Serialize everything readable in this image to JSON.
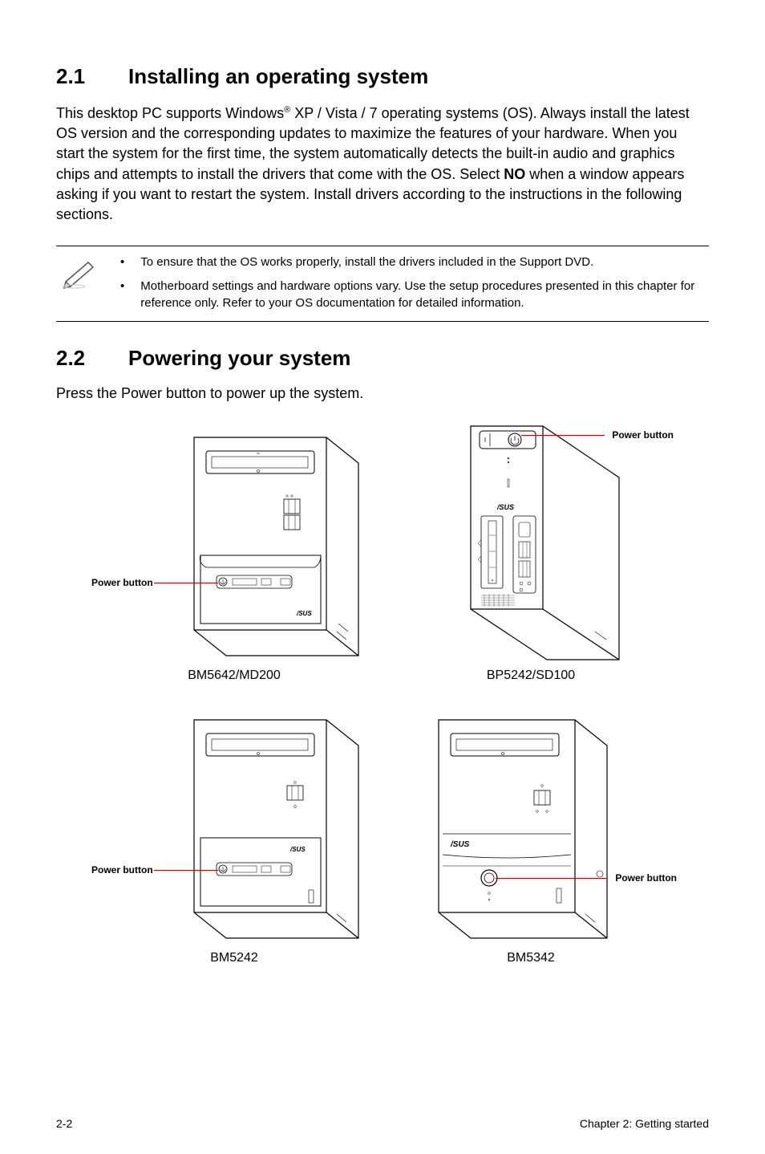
{
  "section1": {
    "number": "2.1",
    "title": "Installing an operating system",
    "intro_pre": "This desktop PC supports Windows",
    "intro_reg": "®",
    "intro_mid": " XP / Vista / 7 operating systems (OS). Always install the latest OS version and the corresponding updates to maximize the features of your hardware. When you start the system for the first time, the system automatically detects the built-in audio and graphics chips and attempts to install the drivers that come with the OS. Select ",
    "intro_bold": "NO",
    "intro_post": " when a window appears asking if you want to restart the system. Install drivers according to the instructions in the following sections."
  },
  "note": {
    "bullet": "•",
    "items": [
      "To ensure that the OS works properly, install the drivers included in the Support DVD.",
      "Motherboard settings and hardware options vary. Use the setup procedures presented in this chapter for reference only. Refer to your OS documentation for detailed information."
    ]
  },
  "section2": {
    "number": "2.2",
    "title": "Powering your system",
    "para": "Press the Power button to power up the system."
  },
  "labels": {
    "power_button": "Power button"
  },
  "captions": {
    "fig1": "BM5642/MD200",
    "fig2": "BP5242/SD100",
    "fig3": "BM5242",
    "fig4": "BM5342"
  },
  "footer": {
    "left": "2-2",
    "right": "Chapter 2: Getting started"
  }
}
